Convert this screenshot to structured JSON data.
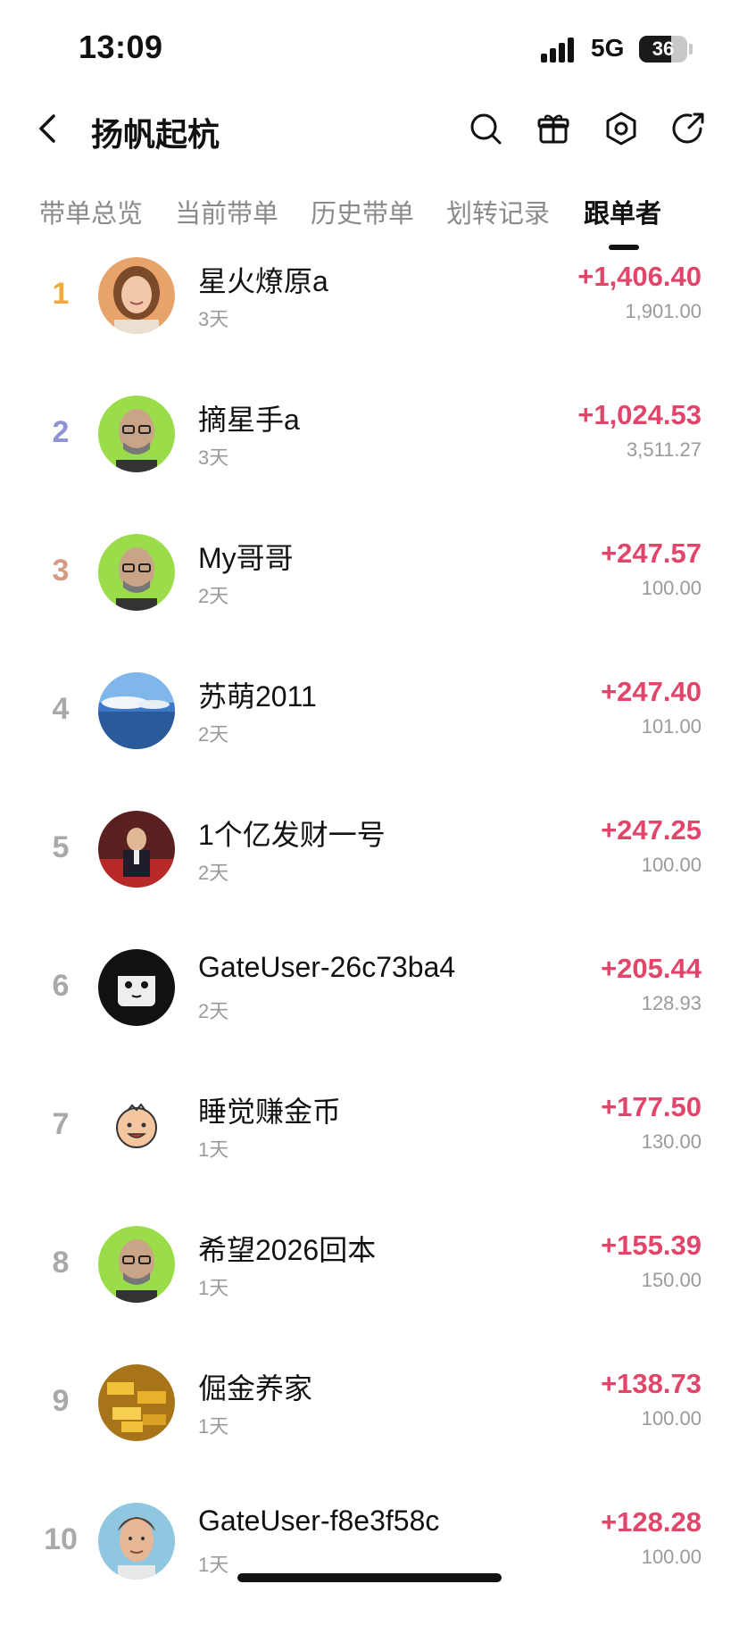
{
  "status_bar": {
    "time": "13:09",
    "network": "5G",
    "battery": "36",
    "battery_level": 0.36
  },
  "header": {
    "title": "扬帆起杭",
    "icons": [
      "back-icon",
      "search-icon",
      "gift-icon",
      "settings-icon",
      "share-icon"
    ]
  },
  "tabs": [
    {
      "label": "带单总览"
    },
    {
      "label": "当前带单"
    },
    {
      "label": "历史带单"
    },
    {
      "label": "划转记录"
    },
    {
      "label": "跟单者",
      "active": true
    }
  ],
  "colors": {
    "profit": "#e1456a",
    "rank1": "#f0a93a",
    "rank2": "#8f93d6",
    "rank3": "#d69a83",
    "rank_default": "#a9a9a9"
  },
  "followers": [
    {
      "rank": "1",
      "name": "星火燎原a",
      "days": "3天",
      "pnl": "+1,406.40",
      "amount": "1,901.00"
    },
    {
      "rank": "2",
      "name": "摘星手a",
      "days": "3天",
      "pnl": "+1,024.53",
      "amount": "3,511.27"
    },
    {
      "rank": "3",
      "name": "My哥哥",
      "days": "2天",
      "pnl": "+247.57",
      "amount": "100.00"
    },
    {
      "rank": "4",
      "name": "苏萌2011",
      "days": "2天",
      "pnl": "+247.40",
      "amount": "101.00"
    },
    {
      "rank": "5",
      "name": "1个亿发财一号",
      "days": "2天",
      "pnl": "+247.25",
      "amount": "100.00"
    },
    {
      "rank": "6",
      "name": "GateUser-26c73ba4",
      "days": "2天",
      "pnl": "+205.44",
      "amount": "128.93"
    },
    {
      "rank": "7",
      "name": "睡觉赚金币",
      "days": "1天",
      "pnl": "+177.50",
      "amount": "130.00"
    },
    {
      "rank": "8",
      "name": "希望2026回本",
      "days": "1天",
      "pnl": "+155.39",
      "amount": "150.00"
    },
    {
      "rank": "9",
      "name": "倔金养家",
      "days": "1天",
      "pnl": "+138.73",
      "amount": "100.00"
    },
    {
      "rank": "10",
      "name": "GateUser-f8e3f58c",
      "days": "1天",
      "pnl": "+128.28",
      "amount": "100.00"
    }
  ]
}
